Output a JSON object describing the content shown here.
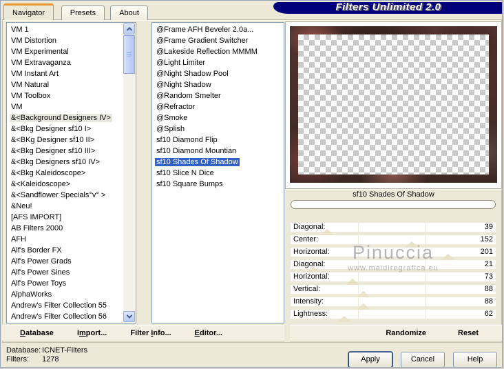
{
  "window": {
    "title": "Filters Unlimited 2.0",
    "colors": {
      "background": "#ece9d8",
      "banner_navy": "#00007a",
      "tab_accent_orange": "#e5962e",
      "selection_blue": "#2f62c4",
      "category_highlight": "#e8e8df",
      "thumb_beige": "#e9e2c6"
    }
  },
  "tabs": [
    {
      "label": "Navigator",
      "active": true
    },
    {
      "label": "Presets",
      "active": false
    },
    {
      "label": "About",
      "active": false
    }
  ],
  "navigator": {
    "categories": {
      "highlighted_index": 8,
      "items": [
        "VM 1",
        "VM Distortion",
        "VM Experimental",
        "VM Extravaganza",
        "VM Instant Art",
        "VM Natural",
        "VM Toolbox",
        "VM",
        "&<Background Designers IV>",
        "&<Bkg Designer sf10 I>",
        "&<BKg Designer sf10 II>",
        "&<Bkg Designer sf10 III>",
        "&<Bkg Designers sf10 IV>",
        "&<Bkg Kaleidoscope>",
        "&<Kaleidoscope>",
        "&<Sandflower Specials°v° >",
        "&Neu!",
        "[AFS IMPORT]",
        "AB Filters 2000",
        "AFH",
        "Alf's Border FX",
        "Alf's Power Grads",
        "Alf's Power Sines",
        "Alf's Power Toys",
        "AlphaWorks",
        "Andrew's Filter Collection 55",
        "Andrew's Filter Collection 56"
      ]
    },
    "filters": {
      "selected_index": 12,
      "items": [
        "@Frame AFH Beveler 2.0a...",
        "@Frame Gradient Switcher",
        "@Lakeside Reflection MMMM",
        "@Light Limiter",
        "@Night Shadow Pool",
        "@Night Shadow",
        "@Random Smelter",
        "@Refractor",
        "@Smoke",
        "@Splish",
        "sf10 Diamond Flip",
        "sf10 Diamond Mountian",
        "sf10 Shades Of Shadow",
        "sf10 Slice N Dice",
        "sf10 Square Bumps"
      ]
    }
  },
  "preview": {
    "filter_name": "sf10 Shades Of Shadow",
    "progress_value": 0
  },
  "sliders": {
    "range": [
      0,
      255
    ],
    "items": [
      {
        "label": "Diagonal:",
        "value": 39
      },
      {
        "label": "Center:",
        "value": 152
      },
      {
        "label": "Horizontal:",
        "value": 201
      },
      {
        "label": "Diagonal:",
        "value": 21
      },
      {
        "label": "Horizontal:",
        "value": 73
      },
      {
        "label": "Vertical:",
        "value": 88
      },
      {
        "label": "Intensity:",
        "value": 88
      },
      {
        "label": "Lightness:",
        "value": 62
      }
    ]
  },
  "watermark": {
    "name": "Pinuccia",
    "url": "www.maidiregrafica.eu"
  },
  "actions_left": [
    {
      "pre": "",
      "u": "D",
      "post": "atabase",
      "name": "database-button"
    },
    {
      "pre": "I",
      "u": "m",
      "post": "port...",
      "name": "import-button"
    },
    {
      "pre": "Filter ",
      "u": "I",
      "post": "nfo...",
      "name": "filter-info-button"
    },
    {
      "pre": "",
      "u": "E",
      "post": "ditor...",
      "name": "editor-button"
    }
  ],
  "actions_right": [
    {
      "label": "Randomize",
      "name": "randomize-button"
    },
    {
      "label": "Reset",
      "name": "reset-button"
    }
  ],
  "status": {
    "rows": [
      {
        "label": "Database:",
        "value": "ICNET-Filters"
      },
      {
        "label": "Filters:",
        "value": "1278"
      }
    ]
  },
  "dialog_buttons": [
    {
      "label": "Apply",
      "default": true,
      "name": "apply-button"
    },
    {
      "label": "Cancel",
      "default": false,
      "name": "cancel-button"
    },
    {
      "label": "Help",
      "default": false,
      "name": "help-button"
    }
  ]
}
